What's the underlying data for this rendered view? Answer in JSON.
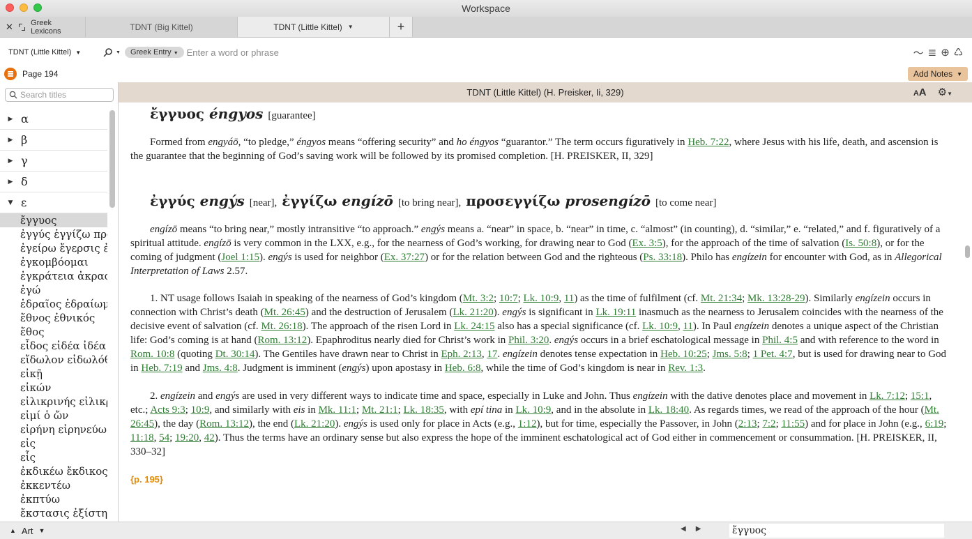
{
  "window": {
    "title": "Workspace"
  },
  "tabs": {
    "panel_label": "Greek Lexicons",
    "items": [
      {
        "label": "TDNT (Big Kittel)"
      },
      {
        "label": "TDNT (Little Kittel)"
      }
    ],
    "plus": "+"
  },
  "toolbar": {
    "resource": "TDNT (Little Kittel)",
    "search_type": "Greek Entry",
    "search_placeholder": "Enter a word or phrase"
  },
  "pagerow": {
    "page": "Page 194",
    "add_notes": "Add Notes"
  },
  "sidebar": {
    "search_placeholder": "Search titles",
    "letters": [
      "α",
      "β",
      "γ",
      "δ",
      "ε"
    ],
    "entries": [
      "ἔγγυος",
      "ἐγγύς ἐγγίζω προσεγγίζω",
      "ἐγείρω ἔγερσις ἐξεγείρω",
      "ἐγκομβόομαι",
      "ἐγκράτεια ἀκρασία",
      "ἐγώ",
      "ἑδραῖος ἑδραίωμα",
      "ἔθνος ἐθνικός",
      "ἔθος",
      "εἶδος εἰδέα ἰδέα",
      "εἴδωλον εἰδωλόθυτον",
      "εἰκῇ",
      "εἰκών",
      "εἰλικρινής εἰλικρίνεια",
      "εἰμί ὁ ὤν",
      "εἰρήνη εἰρηνεύω",
      "εἰς",
      "εἷς",
      "ἐκδικέω ἔκδικος",
      "ἐκκεντέω",
      "ἐκπτύω",
      "ἔκστασις ἐξίστημι"
    ]
  },
  "content": {
    "header": "TDNT (Little Kittel) (H. Preisker, Ii, 329)",
    "entry1": {
      "greek": "ἔγγυος",
      "translit": "éngyos",
      "gloss": "[guarantee]",
      "p1": "Formed from",
      "p1_engyao": "engyáō",
      "p1_b": ", “to pledge,”",
      "p1_engyos": "éngyos",
      "p1_c": "means “offering security” and",
      "p1_ho": "ho éngyos",
      "p1_d": "“guarantor.” The term occurs figuratively in",
      "link_heb722": "Heb. 7:22",
      "p1_e": ", where Jesus with his life, death, and ascension is the guarantee that the beginning of God’s saving work will be followed by its promised completion. [H. PREISKER, II, 329]"
    },
    "entry2": {
      "greek1": "ἐγγύς",
      "translit1": "engýs",
      "gloss1": "[near],",
      "greek2": "ἐγγίζω",
      "translit2": "engízō",
      "gloss2": "[to bring near],",
      "greek3": "προσεγγίζω",
      "translit3": "prosengízō",
      "gloss3": "[to come near]"
    },
    "page_marker": "{p. 195}"
  },
  "bottombar": {
    "label": "Art",
    "field": "ἔγγυος"
  }
}
